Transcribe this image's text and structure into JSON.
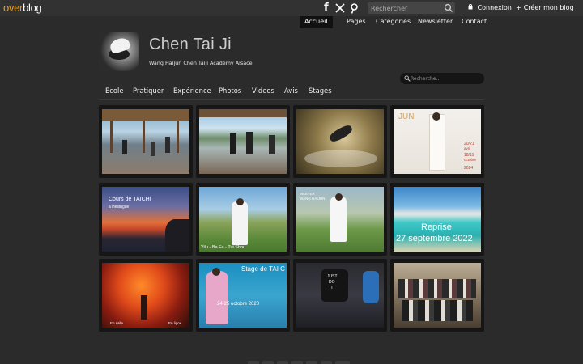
{
  "topbar": {
    "logo_part1": "over",
    "logo_part2": "blog",
    "social_icons": [
      {
        "name": "facebook-icon",
        "glyph": "f"
      },
      {
        "name": "x-twitter-icon",
        "glyph": "𝕏"
      },
      {
        "name": "pinterest-icon",
        "glyph": "p"
      }
    ],
    "search_placeholder": "Rechercher",
    "login_label": "Connexion",
    "create_blog_label": "Créer mon blog",
    "login_icon": "lock-icon",
    "create_icon": "plus-icon"
  },
  "pages_nav": [
    "Accueil",
    "Pages",
    "Catégories",
    "Newsletter",
    "Contact"
  ],
  "header": {
    "title": "Chen Tai Ji",
    "subtitle": "Wang Haijun Chen Taiji Academy Alsace",
    "search_placeholder": "Recherche..."
  },
  "category_nav": [
    "Ecole",
    "Pratiquer",
    "Expérience",
    "Photos",
    "Videos",
    "Avis",
    "Stages"
  ],
  "gallery": {
    "tiles": [
      {
        "name": "photo-outdoor-class-pavilion",
        "captions": []
      },
      {
        "name": "photo-tai-chi-pavilion-lake",
        "captions": []
      },
      {
        "name": "photo-wakeboard-jump",
        "captions": []
      },
      {
        "name": "photo-jun-poster",
        "captions": [
          "JUN",
          "20/21",
          "avril",
          "18/19",
          "octobre",
          "2024"
        ]
      },
      {
        "name": "photo-cours-taichi-sunset",
        "captions": [
          "Cours de TAICHI",
          "à Hésingue"
        ]
      },
      {
        "name": "photo-yilu-bafa-tuishou",
        "captions": [
          "Yilu - Ba Fa - Tui Shou"
        ]
      },
      {
        "name": "photo-master-wang-haijun",
        "captions": [
          "MASTER",
          "WANG HAIJUN"
        ]
      },
      {
        "name": "photo-reprise-septembre",
        "captions": [
          "Reprise",
          "27 septembre 2022"
        ]
      },
      {
        "name": "photo-autumn-tree",
        "captions": [
          "En salle",
          "En ligne"
        ]
      },
      {
        "name": "photo-stage-tai-chi-octobre",
        "captions": [
          "Stage de TAI C",
          "24-25 octobre 2020"
        ]
      },
      {
        "name": "photo-indoor-practice",
        "captions": [
          "JUST",
          "DO",
          "IT"
        ]
      },
      {
        "name": "photo-group-photo",
        "captions": []
      }
    ]
  },
  "colors": {
    "background": "#2b2b2b",
    "topbar": "#323232",
    "logo_accent": "#f39c12",
    "tile_frame": "#161616"
  }
}
